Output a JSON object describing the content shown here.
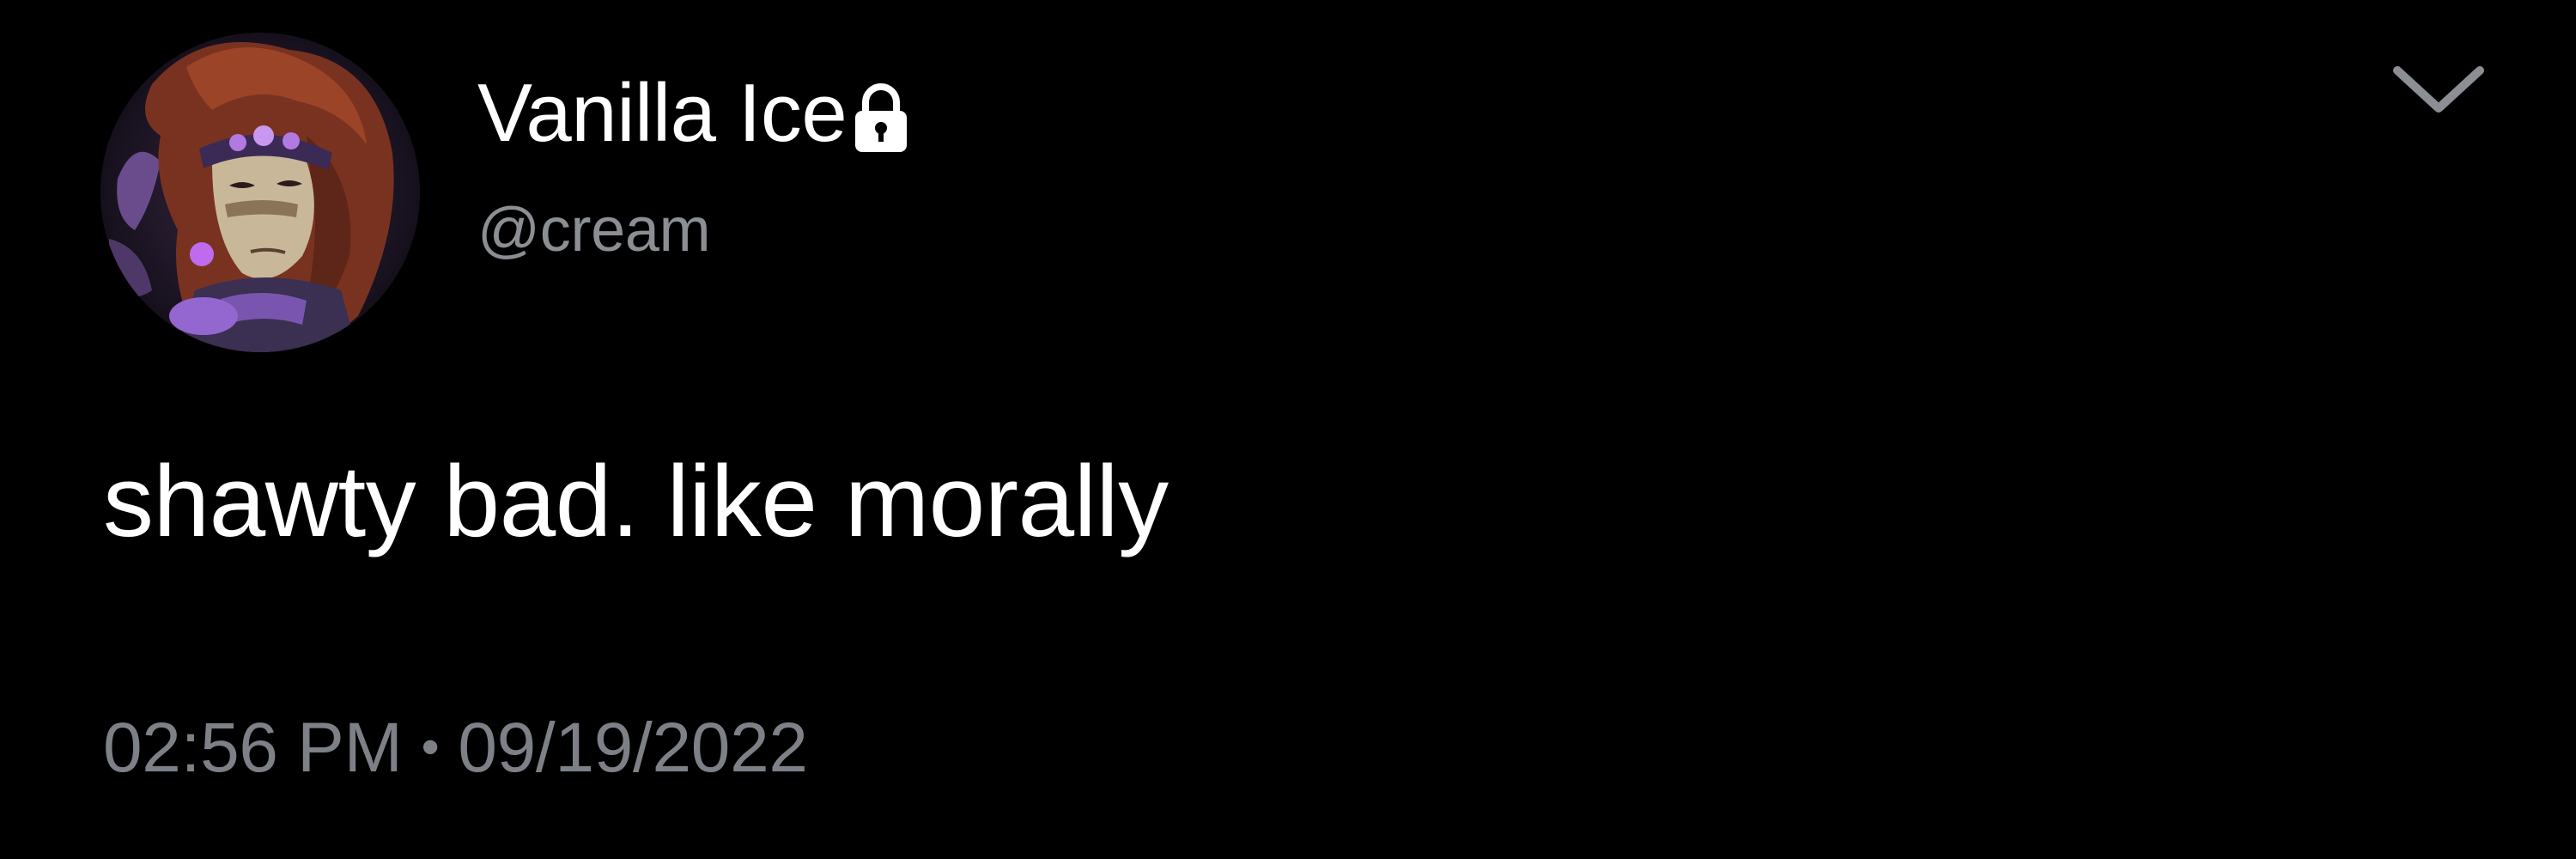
{
  "tweet": {
    "author": {
      "display_name": "Vanilla Ice",
      "handle": "@cream",
      "protected_icon": "lock-icon",
      "avatar": "avatar"
    },
    "menu_icon": "chevron-down-icon",
    "text": "shawty bad. like morally",
    "time": "02:56 PM",
    "separator": "•",
    "date": "09/19/2022"
  },
  "colors": {
    "background": "#000000",
    "primary_text": "#ffffff",
    "secondary_text": "#8b8f94",
    "timestamp_text": "#7d8187"
  }
}
